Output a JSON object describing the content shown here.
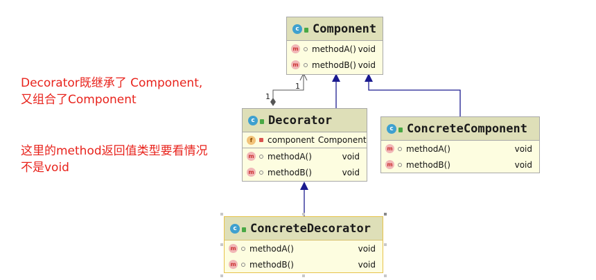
{
  "notes": {
    "line1": "Decorator既继承了 Component,",
    "line2": "又组合了Component",
    "line3": "这里的method返回值类型要看情况",
    "line4": "不是void"
  },
  "classes": {
    "component": {
      "name": "Component",
      "methods": [
        {
          "name": "methodA()",
          "type": "void"
        },
        {
          "name": "methodB()",
          "type": "void"
        }
      ]
    },
    "decorator": {
      "name": "Decorator",
      "field": {
        "name": "component",
        "type": "Component"
      },
      "methods": [
        {
          "name": "methodA()",
          "type": "void"
        },
        {
          "name": "methodB()",
          "type": "void"
        }
      ]
    },
    "concrete_component": {
      "name": "ConcreteComponent",
      "methods": [
        {
          "name": "methodA()",
          "type": "void"
        },
        {
          "name": "methodB()",
          "type": "void"
        }
      ]
    },
    "concrete_decorator": {
      "name": "ConcreteDecorator",
      "methods": [
        {
          "name": "methodA()",
          "type": "void"
        },
        {
          "name": "methodB()",
          "type": "void"
        }
      ]
    }
  },
  "multiplicity": {
    "source": "1",
    "target": "1"
  },
  "icons": {
    "class_icon": "class-c-icon",
    "method_icon": "method-m-icon",
    "field_icon": "field-f-icon"
  },
  "colors": {
    "note_text": "#e8231c",
    "class_header": "#dedfb8",
    "class_body": "#fdfde0",
    "inheritance_arrow": "#1b1b8f"
  }
}
